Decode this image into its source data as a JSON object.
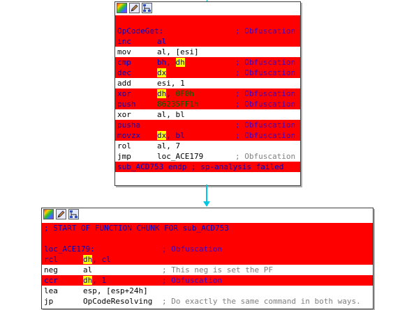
{
  "node1": {
    "toolbar": {
      "icons": [
        "graph-overview-icon",
        "edit-pen-icon",
        "xrefs-icon"
      ]
    },
    "lines": [
      {
        "red": true,
        "mn": "",
        "op": "",
        "cm": ""
      },
      {
        "red": true,
        "mn": "OpCodeGet:",
        "op": "",
        "cm": "; Obfuscation"
      },
      {
        "red": true,
        "mn": "inc",
        "op": "al",
        "cm": ""
      },
      {
        "red": false,
        "mn": "mov",
        "op": "al, [esi]",
        "cm": ""
      },
      {
        "red": true,
        "mn": "cmp",
        "op": "bh, dh",
        "cm": "; Obfuscation"
      },
      {
        "red": true,
        "mn": "dec",
        "op": "dx",
        "cm": "; Obfuscation"
      },
      {
        "red": false,
        "mn": "add",
        "op": "esi, 1",
        "cm": ""
      },
      {
        "red": true,
        "mn": "xor",
        "op": "dh, 0F0h",
        "cm": "; Obfuscation"
      },
      {
        "red": true,
        "mn": "push",
        "op": "86235FF1h",
        "cm": "; Obfuscation"
      },
      {
        "red": false,
        "mn": "xor",
        "op": "al, bl",
        "cm": ""
      },
      {
        "red": true,
        "mn": "pusha",
        "op": "",
        "cm": "; Obfuscation"
      },
      {
        "red": true,
        "mn": "movzx",
        "op": "dx, bl",
        "cm": "; Obfuscation"
      },
      {
        "red": false,
        "mn": "rol",
        "op": "al, 7",
        "cm": ""
      },
      {
        "red": false,
        "mn": "jmp",
        "op": "loc_ACE179",
        "cm": "; Obfuscation"
      },
      {
        "red": true,
        "mn": "sub_ACD753 endp ; sp-analysis failed",
        "op": "",
        "cm": ""
      }
    ]
  },
  "node2": {
    "toolbar": {
      "icons": [
        "graph-overview-icon",
        "edit-pen-icon",
        "xrefs-icon"
      ]
    },
    "lines": [
      {
        "red": true,
        "mn": "; START OF FUNCTION CHUNK FOR sub_ACD753",
        "op": "",
        "cm": ""
      },
      {
        "red": true,
        "mn": "",
        "op": "",
        "cm": ""
      },
      {
        "red": true,
        "mn": "loc_ACE179:",
        "op": "",
        "cm": "; Obfuscation"
      },
      {
        "red": true,
        "mn": "rcl",
        "op": "dh, cl",
        "cm": ""
      },
      {
        "red": false,
        "mn": "neg",
        "op": "al",
        "cm": "; This neg is set the PF"
      },
      {
        "red": true,
        "mn": "ccr",
        "op": "dh, 1",
        "cm": "; Obfuscation"
      },
      {
        "red": false,
        "mn": "lea",
        "op": "esp, [esp+24h]",
        "cm": ""
      },
      {
        "red": false,
        "mn": "jp",
        "op": "OpCodeResolving",
        "cm": "; Do exactly the same command in both ways."
      }
    ]
  }
}
